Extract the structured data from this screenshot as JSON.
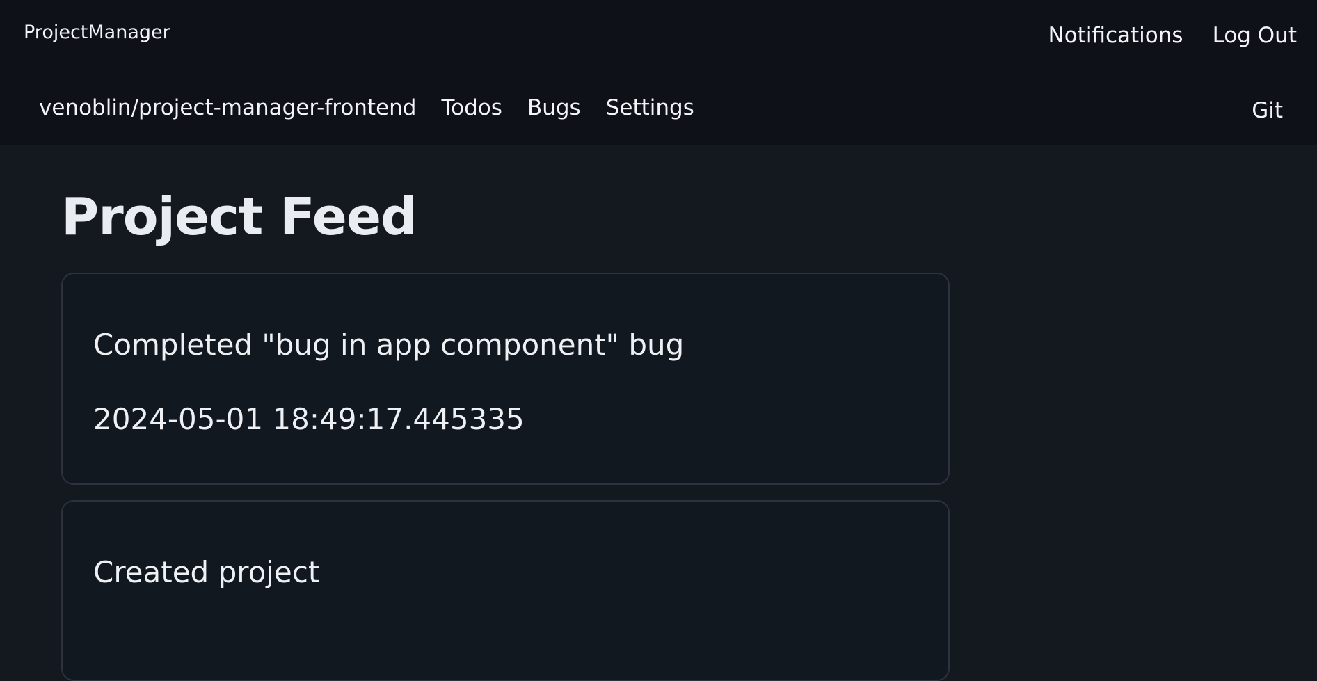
{
  "header": {
    "brand": "ProjectManager",
    "links": {
      "notifications": "Notifications",
      "logout": "Log Out"
    }
  },
  "subnav": {
    "repo": "venoblin/project-manager-frontend",
    "todos": "Todos",
    "bugs": "Bugs",
    "settings": "Settings",
    "git": "Git"
  },
  "main": {
    "title": "Project Feed",
    "feed": [
      {
        "title": "Completed \"bug in app component\" bug",
        "timestamp": "2024-05-01 18:49:17.445335"
      },
      {
        "title": "Created project",
        "timestamp": ""
      }
    ]
  }
}
